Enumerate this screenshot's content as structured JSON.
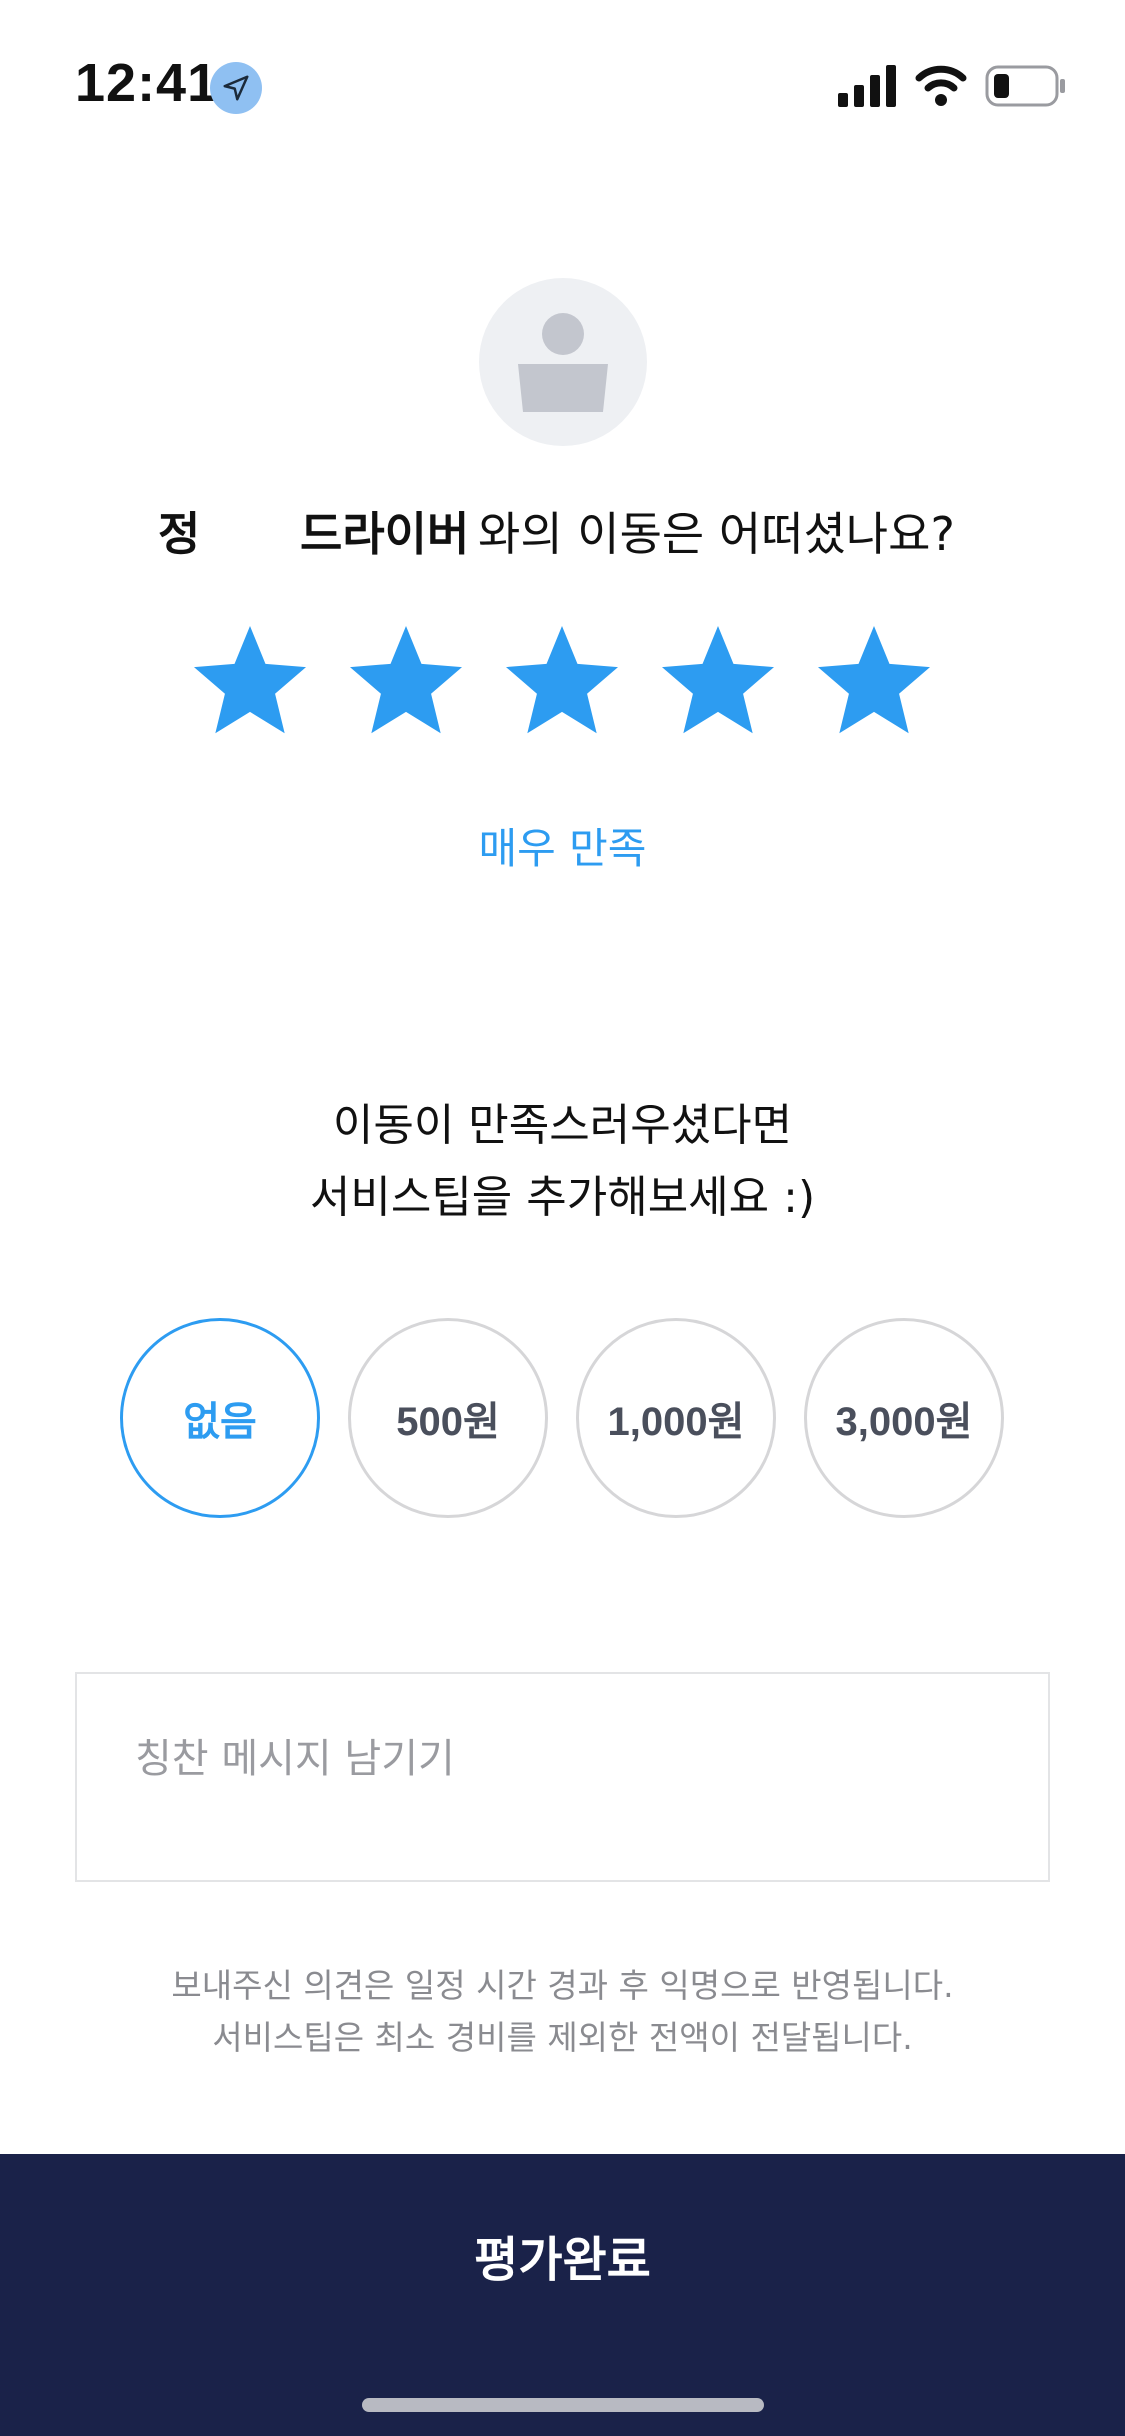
{
  "status_bar": {
    "time": "12:41",
    "icons": [
      "location-arrow-icon",
      "signal-icon",
      "wifi-icon",
      "battery-icon"
    ]
  },
  "rating": {
    "driver_last_name": "정",
    "driver_label": "드라이버",
    "question_rest": "와의 이동은 어떠셨나요?",
    "stars_total": 5,
    "stars_selected": 5,
    "star_color": "#2d9cf1",
    "rating_label": "매우 만족"
  },
  "tip": {
    "prompt_line1": "이동이 만족스러우셨다면",
    "prompt_line2": "서비스팁을 추가해보세요 :)",
    "options": [
      "없음",
      "500원",
      "1,000원",
      "3,000원"
    ],
    "selected": "없음"
  },
  "message": {
    "placeholder": "칭찬 메시지 남기기",
    "value": ""
  },
  "notice": {
    "line1": "보내주신 의견은 일정 시간 경과 후 익명으로 반영됩니다.",
    "line2": "서비스팁은 최소 경비를 제외한 전액이 전달됩니다."
  },
  "submit": {
    "label": "평가완료",
    "background": "#1a2249"
  }
}
